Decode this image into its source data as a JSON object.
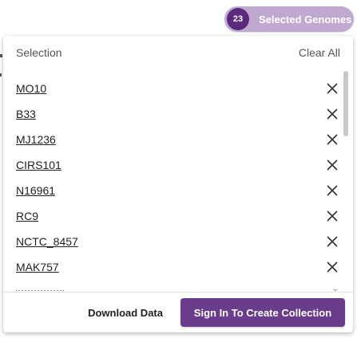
{
  "selected": {
    "count": "23",
    "label": "Selected Genomes"
  },
  "panel": {
    "header_label": "Selection",
    "clear_label": "Clear All",
    "items": [
      {
        "label": "MO10"
      },
      {
        "label": "B33"
      },
      {
        "label": "MJ1236"
      },
      {
        "label": "CIRS101"
      },
      {
        "label": "N16961"
      },
      {
        "label": "RC9"
      },
      {
        "label": "NCTC_8457"
      },
      {
        "label": "MAK757"
      }
    ]
  },
  "footer": {
    "download_label": "Download Data",
    "signin_label": "Sign In To Create Collection"
  },
  "colors": {
    "primary": "#6a3c8c",
    "pill_bg": "#bfa9d0",
    "pill_count_bg": "#5b2a7d"
  }
}
